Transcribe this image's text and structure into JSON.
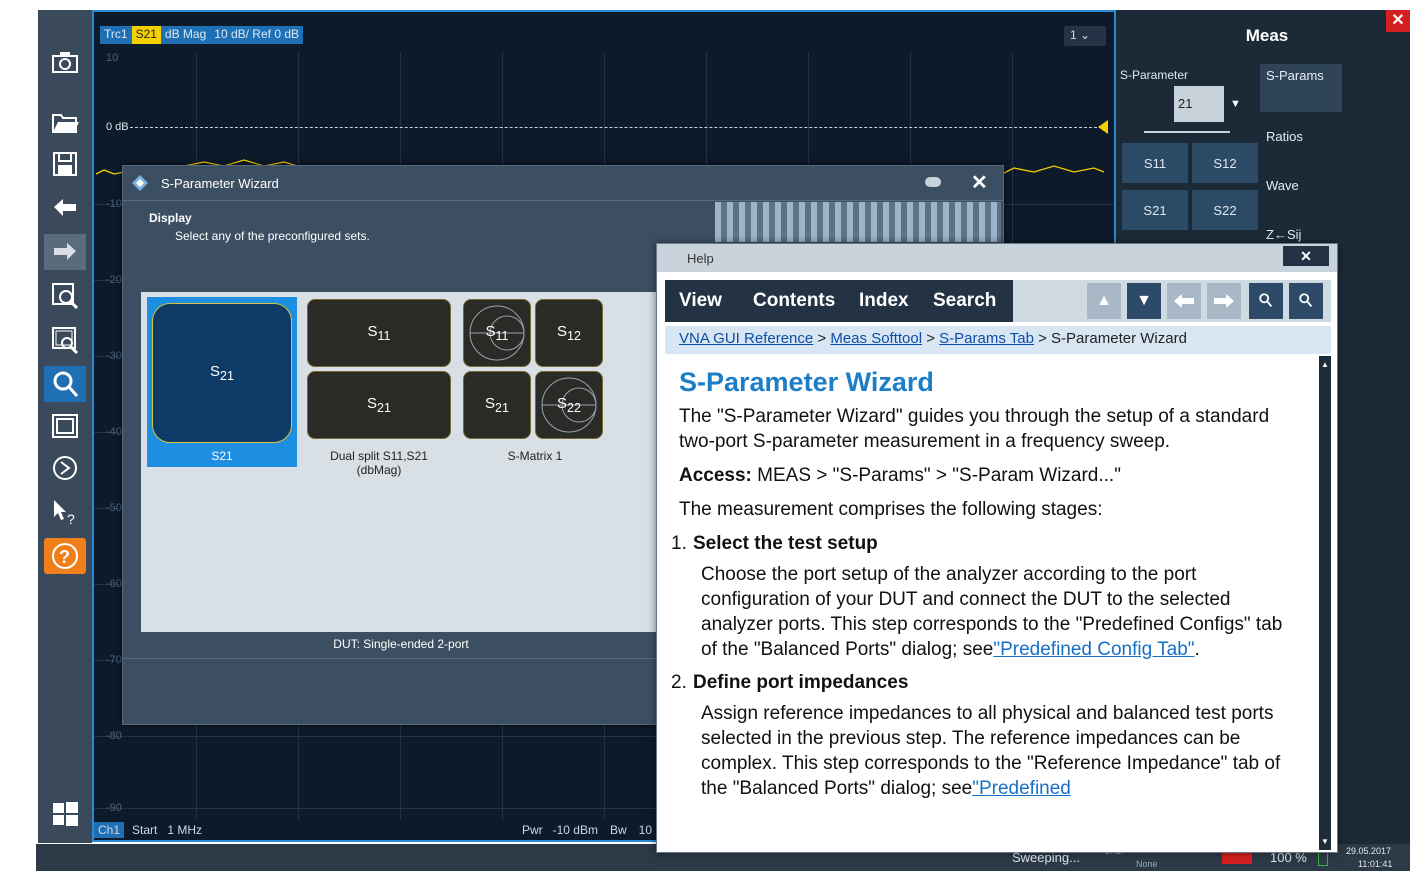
{
  "toolbar": {
    "buttons": [
      "camera-icon",
      "open-folder-icon",
      "save-icon",
      "undo-icon",
      "redo-icon",
      "zoom-select-icon",
      "zoom-window-icon",
      "zoom-icon",
      "fit-screen-icon",
      "autoscale-icon",
      "whats-this-icon",
      "help-icon",
      "windows-icon"
    ]
  },
  "diagram": {
    "trace_labels": [
      "Trc1",
      "S21",
      "dB Mag",
      "10 dB/ Ref 0 dB"
    ],
    "channel_select": "1",
    "zero_label": "0 dB",
    "y_ticks": [
      "10",
      "-10",
      "-20",
      "-30",
      "-40",
      "-50",
      "-60",
      "-70",
      "-80",
      "-90"
    ],
    "status": {
      "channel": "Ch1",
      "start_label": "Start",
      "start_value": "1 MHz",
      "pwr_label": "Pwr",
      "pwr_value": "-10 dBm",
      "bw_label": "Bw",
      "bw_value": "10"
    }
  },
  "meas": {
    "title": "Meas",
    "sparam_label": "S-Parameter",
    "sparam_value": "21",
    "tabs": [
      "S-Params",
      "Ratios",
      "Wave",
      "Z←Sij"
    ],
    "sbuttons": [
      "S11",
      "S12",
      "S21",
      "S22"
    ]
  },
  "wizard": {
    "title": "S-Parameter Wizard",
    "section": "Display",
    "instruction": "Select any of the preconfigured sets.",
    "dut_label": "DUT: Single-ended 2-port",
    "presets": [
      {
        "label": "S21"
      },
      {
        "label": "Dual split S11,S21 (dbMag)"
      },
      {
        "label": "S-Matrix 1"
      }
    ]
  },
  "help": {
    "title": "Help",
    "menus": [
      "View",
      "Contents",
      "Index",
      "Search"
    ],
    "breadcrumb": [
      "VNA GUI Reference",
      "Meas Softtool",
      "S-Params Tab",
      "S-Parameter Wizard"
    ],
    "heading": "S-Parameter Wizard",
    "intro": "The \"S-Parameter Wizard\" guides you through the setup of a standard two-port S-parameter measurement in a frequency sweep.",
    "access_label": "Access:",
    "access_text": "MEAS > \"S-Params\" > \"S-Param Wizard...\"",
    "stages_intro": "The measurement comprises the following stages:",
    "stage1_title": "Select the test setup",
    "stage1_text": "Choose the port setup of the analyzer according to the port configuration of your DUT and connect the DUT to the selected analyzer ports. This step corresponds to the \"Predefined Configs\" tab of the \"Balanced Ports\" dialog; see",
    "stage1_link": "\"Predefined Config Tab\"",
    "stage2_title": "Define port impedances",
    "stage2_text": "Assign reference impedances to all physical and balanced test ports selected in the previous step. The reference impedances can be complex. This step corresponds to the \"Reference Impedance\" tab of the \"Balanced Ports\" dialog; see",
    "stage2_link": "\"Predefined"
  },
  "taskbar": {
    "status": "Sweeping...",
    "ch_label": "Ch1:",
    "none_label": "None",
    "zoom": "100 %",
    "date": "29.05.2017",
    "time": "11:01:41"
  }
}
